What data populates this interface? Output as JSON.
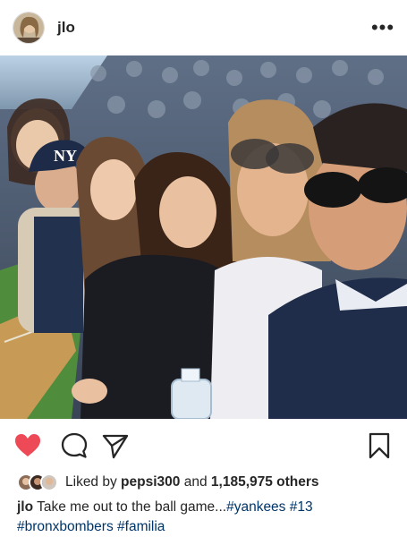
{
  "header": {
    "username": "jlo",
    "avatar_icon": "profile-avatar",
    "more_icon": "more-dots-icon",
    "more_glyph": "•••"
  },
  "photo": {
    "description_icon": "group-selfie-photo"
  },
  "actions": {
    "like_icon": "heart-icon",
    "comment_icon": "comment-bubble-icon",
    "share_icon": "paper-plane-icon",
    "save_icon": "bookmark-icon",
    "like_color": "#ed4956"
  },
  "likes": {
    "prefix": "Liked by",
    "first_user": "pepsi300",
    "connector": "and",
    "others": "1,185,975 others"
  },
  "caption": {
    "username": "jlo",
    "text": "Take me out to the ball game...",
    "tags_line1": [
      "#yankees",
      "#13"
    ],
    "tags_line2": [
      "#bronxbombers",
      "#familia"
    ]
  }
}
